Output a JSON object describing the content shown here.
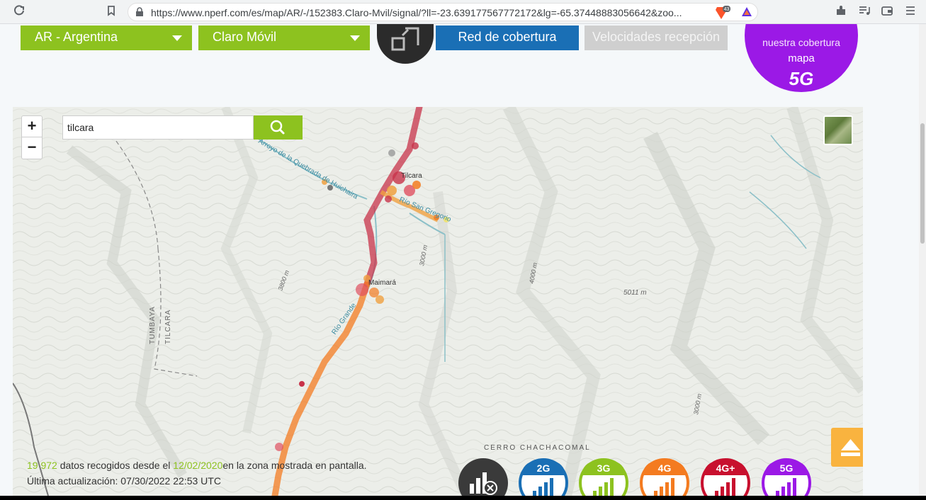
{
  "browser": {
    "url": "https://www.nperf.com/es/map/AR/-/152383.Claro-Mvil/signal/?ll=-23.639177567772172&lg=-65.37448883056642&zoo...",
    "shield_count": "43"
  },
  "header": {
    "country_label": "AR - Argentina",
    "operator_label": "Claro Móvil",
    "coverage_tab_label": "Red de cobertura",
    "speed_tab_label": "Velocidades recepción",
    "promo_line1": "nuestra cobertura",
    "promo_line2": "mapa",
    "promo_badge": "5G"
  },
  "map": {
    "search_value": "tilcara",
    "zoom_in_label": "+",
    "zoom_out_label": "−",
    "labels": {
      "tilcara": "Tilcara",
      "maimara": "Maimará",
      "river1": "Arroyo de la Quebrada de Huichaira",
      "river2": "Río San Gregorio",
      "river3": "Río Grande",
      "elev1": "3800 m",
      "elev2": "3000 m",
      "elev3": "4000 m",
      "elev4": "5011 m",
      "elev5": "3000 m",
      "dept1": "TUMBAYA",
      "dept2": "TILCARA",
      "cerro": "CERRO CHACHACOMAL"
    },
    "stats": {
      "count": "19 972",
      "text1": " datos recogidos desde el ",
      "date": "12/02/2020",
      "text2": "en la zona mostrada en pantalla.",
      "last_update": "Última actualización: 07/30/2022 22:53 UTC"
    },
    "technologies": [
      {
        "label": "",
        "color": "#3a3a3a"
      },
      {
        "label": "2G",
        "color": "#1a6fb5"
      },
      {
        "label": "3G",
        "color": "#8dc21f"
      },
      {
        "label": "4G",
        "color": "#f47b20"
      },
      {
        "label": "4G+",
        "color": "#c8102e"
      },
      {
        "label": "5G",
        "color": "#9b19e6"
      }
    ]
  },
  "colors": {
    "accent_green": "#8dc21f",
    "tab_blue": "#1a6fb5",
    "tab_disabled": "#cfcfcf",
    "promo_purple": "#9b19e6",
    "up_button": "#f9b33f"
  }
}
